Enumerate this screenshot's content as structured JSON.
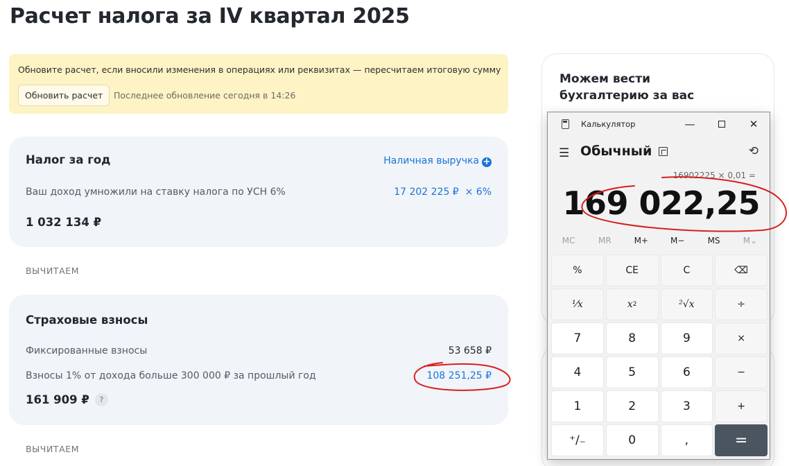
{
  "page": {
    "title": "Расчет налога за IV квартал 2025"
  },
  "notice": {
    "text": "Обновите расчет, если вносили изменения в операциях или реквизитах — пересчитаем итоговую сумму",
    "button_label": "Обновить расчет",
    "last_update": "Последнее обновление сегодня в 14:26",
    "bg_color": "#fdf3c4"
  },
  "tax_card": {
    "title": "Налог за год",
    "cash_link": "Наличная выручка",
    "cash_icon": "plus-circle-icon",
    "row_label": "Ваш доход умножили на ставку налога по УСН 6%",
    "income": "17 202 225 ₽",
    "rate": "× 6%",
    "total": "1 032 134 ₽"
  },
  "section_deduct_1": "ВЫЧИТАЕМ",
  "insurance_card": {
    "title": "Страховые взносы",
    "fixed_label": "Фиксированные взносы",
    "fixed_value": "53 658 ₽",
    "extra_label": "Взносы 1% от дохода больше 300 000 ₽ за прошлый год",
    "extra_value": "108 251,25 ₽",
    "total": "161 909 ₽",
    "help_icon": "?"
  },
  "section_deduct_2": "ВЫЧИТАЕМ",
  "promo": {
    "title": "Можем вести бухгалтерию за вас"
  },
  "calculator": {
    "window_title": "Калькулятор",
    "mode": "Обычный",
    "expression": "16902225 × 0,01 =",
    "display": "169 022,25",
    "memory": [
      {
        "label": "MC",
        "enabled": false
      },
      {
        "label": "MR",
        "enabled": false
      },
      {
        "label": "M+",
        "enabled": true
      },
      {
        "label": "M−",
        "enabled": true
      },
      {
        "label": "MS",
        "enabled": true
      },
      {
        "label": "M⌄",
        "enabled": false
      }
    ],
    "keys": {
      "percent": "%",
      "ce": "CE",
      "c": "C",
      "backspace": "⌫",
      "divide": "÷",
      "multiply": "×",
      "minus": "−",
      "plus": "+",
      "equals": "=",
      "sign": "⁺∕₋",
      "comma": ",",
      "n0": "0",
      "n1": "1",
      "n2": "2",
      "n3": "3",
      "n4": "4",
      "n5": "5",
      "n6": "6",
      "n7": "7",
      "n8": "8",
      "n9": "9"
    },
    "accent_equals": "#4a5560"
  },
  "colors": {
    "link": "#1a73d9",
    "card_bg": "#f1f4f8",
    "annotation": "#d81e1e"
  }
}
